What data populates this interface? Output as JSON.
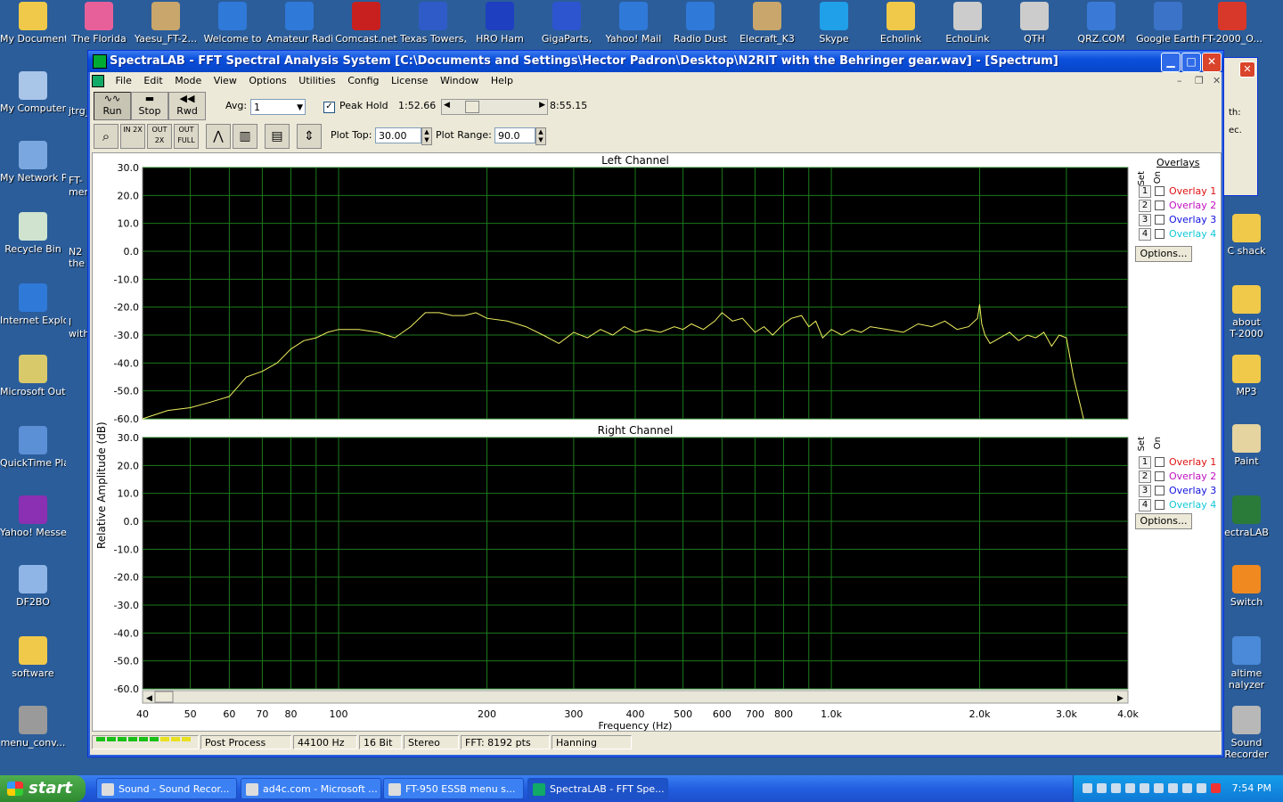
{
  "desktop_left": [
    {
      "label": "My Documents",
      "icon": "folder-documents-icon",
      "color": "#f0c94a"
    },
    {
      "label": "My Computer",
      "icon": "computer-icon",
      "color": "#a9c5e8"
    },
    {
      "label": "My Network Places",
      "icon": "network-icon",
      "color": "#7aa7e0"
    },
    {
      "label": "Recycle Bin",
      "icon": "recycle-bin-icon",
      "color": "#cfe3cf"
    },
    {
      "label": "Internet Explorer",
      "icon": "internet-explorer-icon",
      "color": "#2f79d8"
    },
    {
      "label": "Microsoft Outlook",
      "icon": "outlook-icon",
      "color": "#d8c96a"
    },
    {
      "label": "QuickTime Player",
      "icon": "quicktime-icon",
      "color": "#5b8fd6"
    },
    {
      "label": "Yahoo! Messenger",
      "icon": "yahoo-messenger-icon",
      "color": "#8b2fb3"
    },
    {
      "label": "DF2BO",
      "icon": "df2bo-icon",
      "color": "#8fb4e6"
    },
    {
      "label": "software",
      "icon": "folder-icon",
      "color": "#f0c94a"
    },
    {
      "label": "menu_conv...",
      "icon": "archive-icon",
      "color": "#9a9a9a"
    }
  ],
  "desktop_col2": [
    "jtrg_",
    "FT-",
    "men",
    "N2",
    "the",
    "l",
    "with"
  ],
  "desktop_top": [
    {
      "label": "The Florida",
      "icon": "florida-icon",
      "color": "#e8609a"
    },
    {
      "label": "Yaesu_FT-2...",
      "icon": "yaesu-icon",
      "color": "#c9a66b"
    },
    {
      "label": "Welcome to",
      "icon": "ie-shortcut-icon",
      "color": "#2f79d8"
    },
    {
      "label": "Amateur Radio",
      "icon": "ie-shortcut-icon",
      "color": "#2f79d8"
    },
    {
      "label": "Comcast.net",
      "icon": "comcast-icon",
      "color": "#c8201f"
    },
    {
      "label": "Texas Towers,",
      "icon": "texas-icon",
      "color": "#2f5bc8"
    },
    {
      "label": "HRO Ham",
      "icon": "hro-icon",
      "color": "#1d3fc0"
    },
    {
      "label": "GigaParts,",
      "icon": "gigaparts-icon",
      "color": "#2d55d0"
    },
    {
      "label": "Yahoo! Mail",
      "icon": "ie-shortcut-icon",
      "color": "#2f79d8"
    },
    {
      "label": "Radio Dust",
      "icon": "ie-shortcut-icon",
      "color": "#2f79d8"
    },
    {
      "label": "Elecraft_K3",
      "icon": "elecraft-icon",
      "color": "#c9a66b"
    },
    {
      "label": "Skype",
      "icon": "skype-icon",
      "color": "#1fa0e8"
    },
    {
      "label": "Echolink",
      "icon": "folder-icon",
      "color": "#f0c94a"
    },
    {
      "label": "EchoLink",
      "icon": "echolink-icon",
      "color": "#cccccc"
    },
    {
      "label": "QTH",
      "icon": "qth-icon",
      "color": "#cccccc"
    },
    {
      "label": "QRZ.COM",
      "icon": "qrz-icon",
      "color": "#3a7ad6"
    },
    {
      "label": "Google Earth",
      "icon": "google-earth-icon",
      "color": "#3b73c9"
    },
    {
      "label": "FT-2000_O...",
      "icon": "pdf-icon",
      "color": "#d8382a"
    }
  ],
  "desktop_right": [
    {
      "label": "C shack",
      "icon": "folder-icon",
      "color": "#f0c94a"
    },
    {
      "label": "about",
      "label2": "T-2000",
      "icon": "folder-icon",
      "color": "#f0c94a"
    },
    {
      "label": "MP3",
      "icon": "folder-icon",
      "color": "#f0c94a"
    },
    {
      "label": "Paint",
      "icon": "paint-icon",
      "color": "#e5d3a0"
    },
    {
      "label": "ectraLAB",
      "icon": "spectralab-icon",
      "color": "#2a7a3a"
    },
    {
      "label": "Switch",
      "icon": "switch-icon",
      "color": "#f08a20"
    },
    {
      "label": "altime",
      "label2": "nalyzer",
      "icon": "analyzer-icon",
      "color": "#4a8ad8"
    },
    {
      "label": "Sound",
      "label2": "Recorder",
      "icon": "sound-recorder-icon",
      "color": "#b8b8b8"
    }
  ],
  "bg_window_text": [
    "th:",
    "ec."
  ],
  "window": {
    "title": "SpectraLAB - FFT Spectral Analysis System [C:\\Documents and Settings\\Hector Padron\\Desktop\\N2RIT with the Behringer gear.wav] - [Spectrum]",
    "menus": [
      "File",
      "Edit",
      "Mode",
      "View",
      "Options",
      "Utilities",
      "Config",
      "License",
      "Window",
      "Help"
    ],
    "run": "Run",
    "stop": "Stop",
    "rwd": "Rwd",
    "avg_label": "Avg:",
    "avg_value": "1",
    "peak_hold_label": "Peak Hold",
    "peak_hold_checked": "✓",
    "time_pos": "1:52.66",
    "time_total": "8:55.15",
    "zoom_btns": [
      "IN 2X",
      "OUT 2X",
      "OUT FULL"
    ],
    "plot_top_label": "Plot Top:",
    "plot_top_value": "30.00",
    "plot_range_label": "Plot Range:",
    "plot_range_value": "90.0"
  },
  "overlays": {
    "header": "Overlays",
    "set": "Set",
    "on": "On",
    "items": [
      {
        "num": "1",
        "label": "Overlay 1",
        "color": "#e01010"
      },
      {
        "num": "2",
        "label": "Overlay 2",
        "color": "#c010c0"
      },
      {
        "num": "3",
        "label": "Overlay 3",
        "color": "#1010e0"
      },
      {
        "num": "4",
        "label": "Overlay 4",
        "color": "#10c8d8"
      }
    ],
    "options": "Options..."
  },
  "status": {
    "mode": "Post Process",
    "rate": "44100 Hz",
    "bits": "16 Bit",
    "channels": "Stereo",
    "fft": "FFT: 8192 pts",
    "window": "Hanning"
  },
  "chart_data": [
    {
      "type": "line",
      "title": "Left Channel",
      "ylabel": "Relative Amplitude (dB)",
      "xlabel": "Frequency (Hz)",
      "xscale": "log",
      "xlim": [
        40,
        4000
      ],
      "ylim": [
        -60,
        30
      ],
      "yticks": [
        "30.0",
        "20.0",
        "10.0",
        "0.0",
        "-10.0",
        "-20.0",
        "-30.0",
        "-40.0",
        "-50.0",
        "-60.0"
      ],
      "xticks": [
        "40",
        "50",
        "60",
        "70",
        "80",
        "100",
        "200",
        "300",
        "400",
        "500",
        "600",
        "700",
        "800",
        "1.0k",
        "2.0k",
        "3.0k",
        "4.0k"
      ],
      "grid": true,
      "line_color": "#f0f060",
      "background": "#000000",
      "x": [
        40,
        45,
        50,
        55,
        60,
        65,
        70,
        75,
        80,
        85,
        90,
        95,
        100,
        110,
        120,
        130,
        140,
        150,
        160,
        170,
        180,
        190,
        200,
        220,
        240,
        260,
        280,
        300,
        320,
        340,
        360,
        380,
        400,
        420,
        450,
        480,
        500,
        520,
        550,
        580,
        600,
        630,
        660,
        700,
        730,
        760,
        800,
        830,
        870,
        900,
        930,
        960,
        1000,
        1050,
        1100,
        1150,
        1200,
        1300,
        1400,
        1500,
        1600,
        1700,
        1800,
        1900,
        1980,
        2000,
        2020,
        2050,
        2100,
        2200,
        2300,
        2400,
        2500,
        2600,
        2700,
        2800,
        2900,
        3000,
        3050,
        3100,
        3150,
        3200,
        3250
      ],
      "values": [
        -60,
        -57,
        -56,
        -54,
        -52,
        -45,
        -43,
        -40,
        -35,
        -32,
        -31,
        -29,
        -28,
        -28,
        -29,
        -31,
        -27,
        -22,
        -22,
        -23,
        -23,
        -22,
        -24,
        -25,
        -27,
        -30,
        -33,
        -29,
        -31,
        -28,
        -30,
        -27,
        -29,
        -28,
        -29,
        -27,
        -28,
        -26,
        -28,
        -25,
        -22,
        -25,
        -24,
        -29,
        -27,
        -30,
        -26,
        -24,
        -23,
        -27,
        -25,
        -31,
        -28,
        -30,
        -28,
        -29,
        -27,
        -28,
        -29,
        -26,
        -27,
        -25,
        -28,
        -27,
        -24,
        -19,
        -26,
        -30,
        -33,
        -31,
        -29,
        -32,
        -30,
        -31,
        -29,
        -34,
        -30,
        -31,
        -38,
        -45,
        -50,
        -55,
        -60
      ]
    },
    {
      "type": "line",
      "title": "Right Channel",
      "xlabel": "Frequency (Hz)",
      "xscale": "log",
      "xlim": [
        40,
        4000
      ],
      "ylim": [
        -60,
        30
      ],
      "yticks": [
        "30.0",
        "20.0",
        "10.0",
        "0.0",
        "-10.0",
        "-20.0",
        "-30.0",
        "-40.0",
        "-50.0",
        "-60.0"
      ],
      "grid": true,
      "background": "#000000",
      "x": [],
      "values": []
    }
  ],
  "taskbar": {
    "start": "start",
    "tasks": [
      "Sound - Sound Recor...",
      "ad4c.com - Microsoft ...",
      "FT-950  ESSB menu s...",
      "SpectraLAB - FFT Spe..."
    ],
    "clock": "7:54 PM"
  }
}
